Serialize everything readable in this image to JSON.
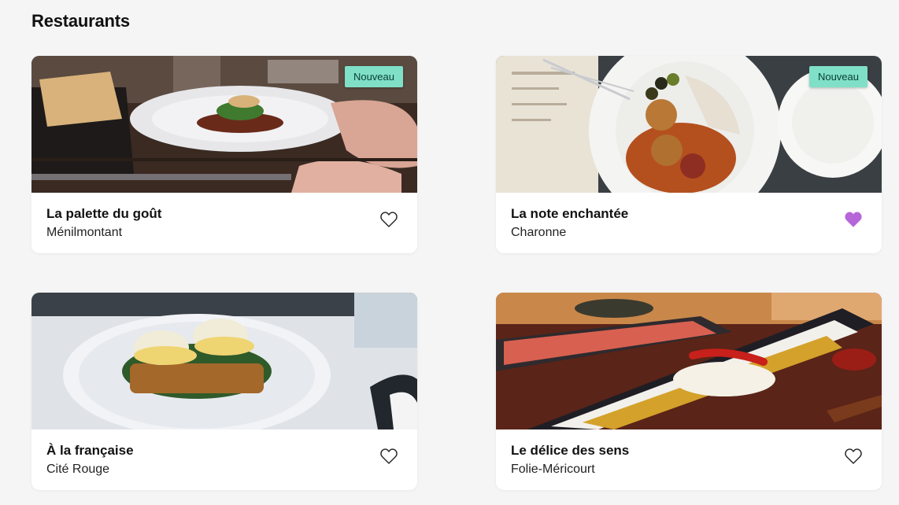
{
  "section": {
    "title": "Restaurants"
  },
  "restaurants": [
    {
      "name": "La palette du goût",
      "district": "Ménilmontant",
      "badge": "Nouveau",
      "favorite": false,
      "icon": "heart-outline-icon"
    },
    {
      "name": "La note enchantée",
      "district": "Charonne",
      "badge": "Nouveau",
      "favorite": true,
      "icon": "heart-filled-icon"
    },
    {
      "name": "À la française",
      "district": "Cité Rouge",
      "badge": "",
      "favorite": false,
      "icon": "heart-outline-icon"
    },
    {
      "name": "Le délice des sens",
      "district": "Folie-Méricourt",
      "badge": "",
      "favorite": false,
      "icon": "heart-outline-icon"
    }
  ],
  "colors": {
    "badge_bg": "#7fe0c7",
    "favorite_active": "#b666d9",
    "favorite_inactive": "#222222",
    "page_bg": "#f5f5f5"
  }
}
